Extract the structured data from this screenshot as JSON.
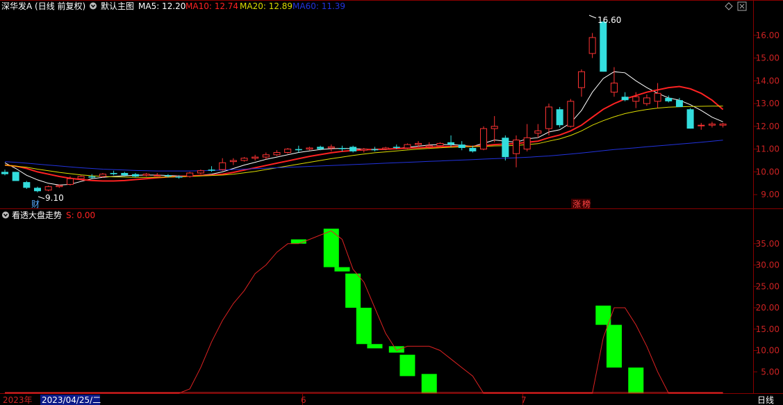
{
  "header": {
    "stock_title": "深华发A (日线 前复权)",
    "main_label": "默认主图",
    "ma5": "MA5: 12.20",
    "ma10": "MA10: 12.74",
    "ma20": "MA20: 12.89",
    "ma60": "MA60: 11.39"
  },
  "indicator_header": {
    "name": "看透大盘走势",
    "value": "S: 0.00"
  },
  "markers": {
    "cai": "财",
    "zhang": "涨",
    "bang": "榜",
    "high_label": "16.60",
    "low_label": "9.10"
  },
  "bottom": {
    "year": "2023年",
    "date": "2023/04/25/二",
    "month6": "6",
    "month7": "7",
    "period": "日线"
  },
  "colors": {
    "up": "#ff3333",
    "down": "#33dddd",
    "ma5": "#ffffff",
    "ma10": "#ff2222",
    "ma20": "#dddd00",
    "ma60": "#2233dd",
    "grid": "#8a0000",
    "indicator_bar": "#00ff00",
    "indicator_line": "#dd2222"
  },
  "chart_data": [
    {
      "type": "candlestick",
      "title": "深华发A (日线 前复权)",
      "ylim": [
        8.7,
        17.0
      ],
      "yticks": [
        "9.00",
        "10.00",
        "11.00",
        "12.00",
        "13.00",
        "14.00",
        "15.00",
        "16.00"
      ],
      "ohlc": [
        [
          10.0,
          10.1,
          9.85,
          9.9
        ],
        [
          10.0,
          10.0,
          9.6,
          9.6
        ],
        [
          9.55,
          9.6,
          9.25,
          9.3
        ],
        [
          9.3,
          9.35,
          9.1,
          9.15
        ],
        [
          9.2,
          9.4,
          9.15,
          9.35
        ],
        [
          9.35,
          9.45,
          9.3,
          9.4
        ],
        [
          9.45,
          9.8,
          9.4,
          9.7
        ],
        [
          9.7,
          9.85,
          9.65,
          9.8
        ],
        [
          9.8,
          9.9,
          9.7,
          9.75
        ],
        [
          9.8,
          9.95,
          9.75,
          9.9
        ],
        [
          9.95,
          10.05,
          9.85,
          9.9
        ],
        [
          9.95,
          10.0,
          9.8,
          9.85
        ],
        [
          9.9,
          9.95,
          9.75,
          9.8
        ],
        [
          9.85,
          9.95,
          9.8,
          9.9
        ],
        [
          9.85,
          9.95,
          9.8,
          9.85
        ],
        [
          9.85,
          9.9,
          9.75,
          9.8
        ],
        [
          9.8,
          9.85,
          9.7,
          9.75
        ],
        [
          9.8,
          10.0,
          9.75,
          9.95
        ],
        [
          9.95,
          10.1,
          9.9,
          10.05
        ],
        [
          10.1,
          10.25,
          10.0,
          10.05
        ],
        [
          10.1,
          10.6,
          10.05,
          10.4
        ],
        [
          10.45,
          10.6,
          10.3,
          10.5
        ],
        [
          10.5,
          10.65,
          10.45,
          10.6
        ],
        [
          10.6,
          10.75,
          10.5,
          10.65
        ],
        [
          10.65,
          10.85,
          10.55,
          10.75
        ],
        [
          10.75,
          10.95,
          10.7,
          10.85
        ],
        [
          10.85,
          11.05,
          10.8,
          11.0
        ],
        [
          11.0,
          11.15,
          10.85,
          10.95
        ],
        [
          11.0,
          11.1,
          10.95,
          11.05
        ],
        [
          11.1,
          11.15,
          10.95,
          11.0
        ],
        [
          11.05,
          11.2,
          10.9,
          11.1
        ],
        [
          11.05,
          11.15,
          10.9,
          11.0
        ],
        [
          11.1,
          11.15,
          10.85,
          10.9
        ],
        [
          10.95,
          11.05,
          10.85,
          11.0
        ],
        [
          11.0,
          11.1,
          10.9,
          10.95
        ],
        [
          11.0,
          11.1,
          10.95,
          11.05
        ],
        [
          11.1,
          11.2,
          11.0,
          11.05
        ],
        [
          11.05,
          11.25,
          11.0,
          11.2
        ],
        [
          11.2,
          11.35,
          11.1,
          11.25
        ],
        [
          11.1,
          11.3,
          11.0,
          11.15
        ],
        [
          11.15,
          11.3,
          11.05,
          11.25
        ],
        [
          11.3,
          11.6,
          11.1,
          11.2
        ],
        [
          11.2,
          11.35,
          10.95,
          11.05
        ],
        [
          11.05,
          11.15,
          10.85,
          10.9
        ],
        [
          11.0,
          12.0,
          10.95,
          11.9
        ],
        [
          11.9,
          12.45,
          11.3,
          12.0
        ],
        [
          11.5,
          11.6,
          10.5,
          10.65
        ],
        [
          10.8,
          11.6,
          10.2,
          11.4
        ],
        [
          11.0,
          12.1,
          10.9,
          11.5
        ],
        [
          11.7,
          12.1,
          11.5,
          11.8
        ],
        [
          11.9,
          13.0,
          11.6,
          12.85
        ],
        [
          12.75,
          12.85,
          11.95,
          12.05
        ],
        [
          12.0,
          13.2,
          11.95,
          13.1
        ],
        [
          13.7,
          14.5,
          13.3,
          14.4
        ],
        [
          15.2,
          16.1,
          15.0,
          15.9
        ],
        [
          16.6,
          16.6,
          14.4,
          14.4
        ],
        [
          13.5,
          14.6,
          13.3,
          13.9
        ],
        [
          13.3,
          13.5,
          13.1,
          13.15
        ],
        [
          13.1,
          13.5,
          12.8,
          13.3
        ],
        [
          13.0,
          13.4,
          12.9,
          13.25
        ],
        [
          13.1,
          13.9,
          12.8,
          13.45
        ],
        [
          13.25,
          13.35,
          13.05,
          13.1
        ],
        [
          13.15,
          13.25,
          12.85,
          12.85
        ],
        [
          12.75,
          12.8,
          11.9,
          11.9
        ],
        [
          12.05,
          12.15,
          11.85,
          12.05
        ],
        [
          12.05,
          12.2,
          11.95,
          12.1
        ],
        [
          12.05,
          12.15,
          11.95,
          12.1
        ]
      ],
      "series": [
        {
          "name": "MA5",
          "values": [
            10.4,
            10.15,
            9.85,
            9.65,
            9.5,
            9.42,
            9.45,
            9.58,
            9.7,
            9.76,
            9.8,
            9.83,
            9.85,
            9.86,
            9.86,
            9.84,
            9.82,
            9.82,
            9.85,
            9.9,
            10.0,
            10.15,
            10.3,
            10.42,
            10.55,
            10.65,
            10.75,
            10.85,
            10.92,
            10.98,
            11.02,
            11.03,
            11.02,
            11.0,
            10.98,
            10.98,
            11.02,
            11.08,
            11.13,
            11.18,
            11.2,
            11.2,
            11.17,
            11.12,
            11.25,
            11.4,
            11.35,
            11.3,
            11.45,
            11.5,
            11.75,
            11.85,
            12.15,
            12.7,
            13.5,
            14.1,
            14.4,
            14.35,
            14.0,
            13.7,
            13.45,
            13.25,
            13.15,
            12.95,
            12.7,
            12.4,
            12.2
          ]
        },
        {
          "name": "MA10",
          "values": [
            10.3,
            10.25,
            10.15,
            10.0,
            9.9,
            9.8,
            9.72,
            9.66,
            9.62,
            9.6,
            9.6,
            9.62,
            9.66,
            9.7,
            9.74,
            9.78,
            9.8,
            9.82,
            9.84,
            9.86,
            9.9,
            9.98,
            10.08,
            10.18,
            10.28,
            10.38,
            10.48,
            10.58,
            10.68,
            10.76,
            10.84,
            10.9,
            10.94,
            10.97,
            10.99,
            11.0,
            11.02,
            11.04,
            11.06,
            11.08,
            11.1,
            11.12,
            11.12,
            11.12,
            11.15,
            11.2,
            11.22,
            11.24,
            11.3,
            11.35,
            11.5,
            11.62,
            11.8,
            12.05,
            12.4,
            12.75,
            13.0,
            13.2,
            13.35,
            13.5,
            13.6,
            13.7,
            13.75,
            13.65,
            13.45,
            13.15,
            12.74
          ]
        },
        {
          "name": "MA20",
          "values": [
            10.3,
            10.25,
            10.2,
            10.12,
            10.05,
            9.98,
            9.92,
            9.87,
            9.83,
            9.8,
            9.78,
            9.77,
            9.76,
            9.76,
            9.76,
            9.77,
            9.78,
            9.8,
            9.82,
            9.84,
            9.86,
            9.9,
            9.96,
            10.02,
            10.1,
            10.18,
            10.26,
            10.34,
            10.42,
            10.5,
            10.58,
            10.65,
            10.72,
            10.78,
            10.84,
            10.88,
            10.92,
            10.96,
            11.0,
            11.03,
            11.06,
            11.08,
            11.1,
            11.11,
            11.12,
            11.14,
            11.15,
            11.16,
            11.2,
            11.24,
            11.35,
            11.45,
            11.6,
            11.8,
            12.05,
            12.25,
            12.42,
            12.56,
            12.66,
            12.74,
            12.8,
            12.84,
            12.86,
            12.87,
            12.88,
            12.89,
            12.89
          ]
        },
        {
          "name": "MA60",
          "values": [
            10.45,
            10.42,
            10.38,
            10.34,
            10.3,
            10.26,
            10.22,
            10.18,
            10.15,
            10.12,
            10.1,
            10.08,
            10.06,
            10.05,
            10.04,
            10.04,
            10.04,
            10.04,
            10.05,
            10.06,
            10.08,
            10.1,
            10.12,
            10.14,
            10.16,
            10.18,
            10.2,
            10.22,
            10.24,
            10.26,
            10.28,
            10.3,
            10.32,
            10.34,
            10.36,
            10.38,
            10.4,
            10.42,
            10.44,
            10.46,
            10.48,
            10.5,
            10.52,
            10.54,
            10.56,
            10.58,
            10.6,
            10.62,
            10.64,
            10.67,
            10.7,
            10.74,
            10.78,
            10.83,
            10.88,
            10.93,
            10.98,
            11.02,
            11.06,
            11.1,
            11.14,
            11.18,
            11.22,
            11.26,
            11.3,
            11.35,
            11.39
          ]
        }
      ]
    },
    {
      "type": "bar",
      "title": "看透大盘走势",
      "ylim": [
        0,
        40
      ],
      "yticks": [
        "5.00",
        "10.00",
        "15.00",
        "20.00",
        "25.00",
        "30.00",
        "35.00"
      ],
      "line_values": [
        0,
        0,
        0,
        0,
        0,
        0,
        0,
        0,
        0,
        0,
        0,
        0,
        0,
        0,
        0,
        0,
        0,
        1,
        6,
        12,
        17,
        21,
        24,
        28,
        30,
        33,
        35,
        35,
        36,
        37,
        38,
        36,
        29,
        26,
        20,
        14,
        10,
        11,
        11,
        11,
        10,
        8,
        6,
        4,
        0,
        0,
        0,
        0,
        0,
        0,
        0,
        0,
        0,
        0,
        0,
        13,
        20,
        20,
        16,
        11,
        5,
        0,
        0,
        0,
        0,
        0,
        0
      ],
      "bars": [
        {
          "i": 27,
          "top": 36,
          "bottom": 35
        },
        {
          "i": 30,
          "top": 38.5,
          "bottom": 29.5
        },
        {
          "i": 31,
          "top": 29.5,
          "bottom": 28.5
        },
        {
          "i": 32,
          "top": 28,
          "bottom": 20
        },
        {
          "i": 33,
          "top": 20,
          "bottom": 11.5
        },
        {
          "i": 34,
          "top": 11.5,
          "bottom": 10.5
        },
        {
          "i": 36,
          "top": 11,
          "bottom": 9.5
        },
        {
          "i": 37,
          "top": 9,
          "bottom": 4
        },
        {
          "i": 39,
          "top": 4.5,
          "bottom": 0
        },
        {
          "i": 55,
          "top": 20.5,
          "bottom": 16
        },
        {
          "i": 56,
          "top": 16,
          "bottom": 6
        },
        {
          "i": 58,
          "top": 6,
          "bottom": 0
        }
      ]
    }
  ]
}
